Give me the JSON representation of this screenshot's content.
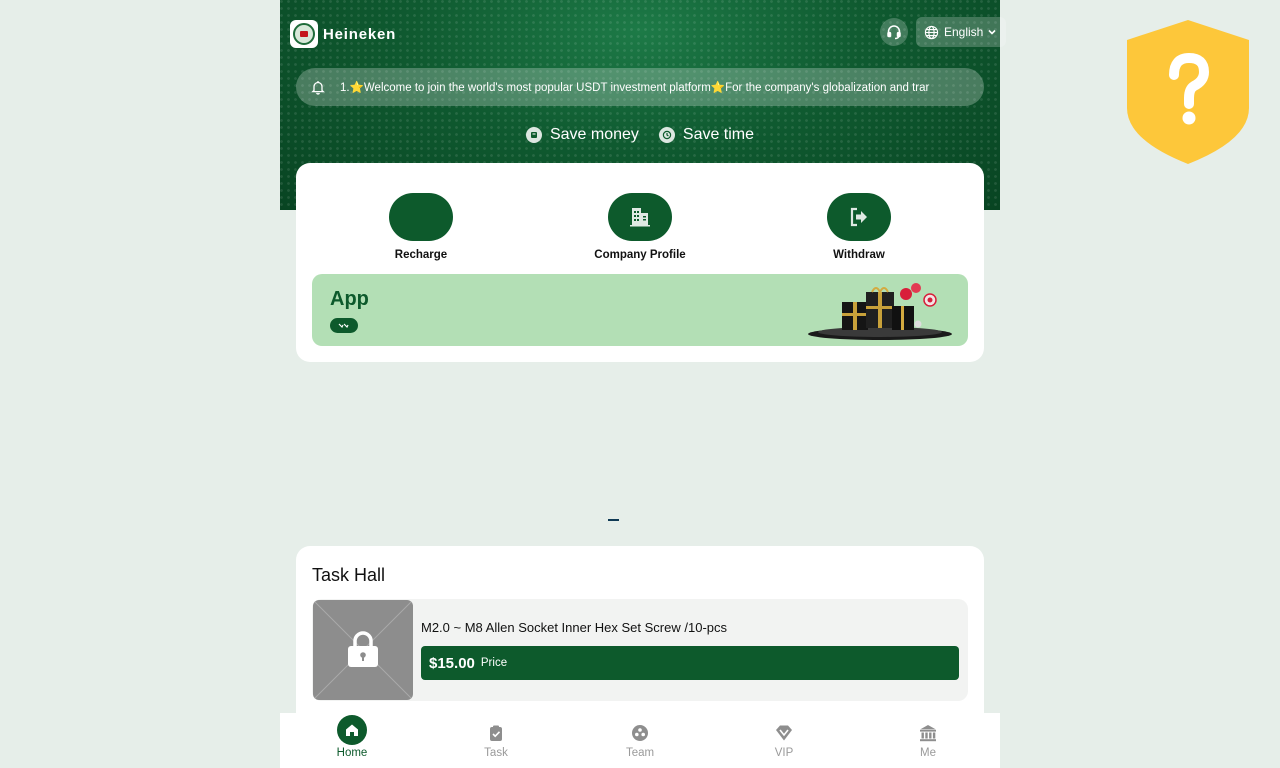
{
  "header": {
    "brand": "Heineken",
    "language": "English",
    "support_icon": "headset-icon",
    "language_icon": "globe-icon"
  },
  "notice": {
    "icon": "bell-icon",
    "text": "1.⭐Welcome to join the world's most popular USDT investment platform⭐For the company's globalization and trar"
  },
  "slogans": [
    "Save money",
    "Save time"
  ],
  "actions": [
    {
      "label": "Recharge",
      "icon": "wallet-icon"
    },
    {
      "label": "Company Profile",
      "icon": "building-icon"
    },
    {
      "label": "Withdraw",
      "icon": "exit-icon"
    }
  ],
  "app_banner": {
    "title": "App",
    "pill_icon": "download-icon"
  },
  "task_hall": {
    "title": "Task Hall",
    "items": [
      {
        "name": "M2.0 ~ M8 Allen Socket Inner Hex Set Screw /10-pcs",
        "price": "$15.00",
        "price_label": "Price",
        "thumb_icon": "lock-icon"
      }
    ]
  },
  "tabs": [
    {
      "label": "Home",
      "icon": "home-icon",
      "active": true
    },
    {
      "label": "Task",
      "icon": "clipboard-icon",
      "active": false
    },
    {
      "label": "Team",
      "icon": "team-icon",
      "active": false
    },
    {
      "label": "VIP",
      "icon": "diamond-icon",
      "active": false
    },
    {
      "label": "Me",
      "icon": "bank-icon",
      "active": false
    }
  ],
  "colors": {
    "brand_green": "#0d5a2c",
    "banner_green": "#b3dfb5",
    "shield_yellow": "#fdc73a",
    "background": "#e6eee9"
  }
}
